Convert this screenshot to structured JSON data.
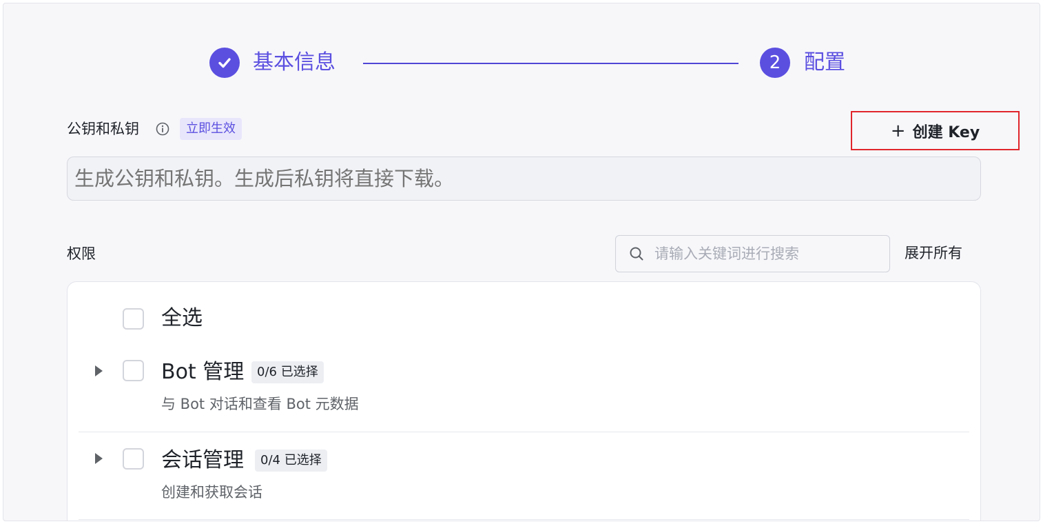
{
  "stepper": {
    "steps": [
      {
        "label": "基本信息",
        "status": "completed",
        "icon": "check-icon"
      },
      {
        "label": "配置",
        "status": "active",
        "number": "2"
      }
    ],
    "accent_color": "#5b4fe0"
  },
  "key_section": {
    "label": "公钥和私钥",
    "info_icon": "info-icon",
    "tag": "立即生效",
    "create_button_label": "创建 Key",
    "create_button_icon": "plus-icon",
    "textarea_placeholder": "生成公钥和私钥。生成后私钥将直接下载。"
  },
  "permissions": {
    "label": "权限",
    "search_placeholder": "请输入关键词进行搜索",
    "expand_all_label": "展开所有",
    "select_all_label": "全选",
    "groups": [
      {
        "title": "Bot 管理",
        "count": "0/6 已选择",
        "description": "与 Bot 对话和查看 Bot 元数据"
      },
      {
        "title": "会话管理",
        "count": "0/4 已选择",
        "description": "创建和获取会话"
      }
    ]
  },
  "colors": {
    "accent": "#5b4fe0",
    "highlight_border": "#e0252b"
  }
}
